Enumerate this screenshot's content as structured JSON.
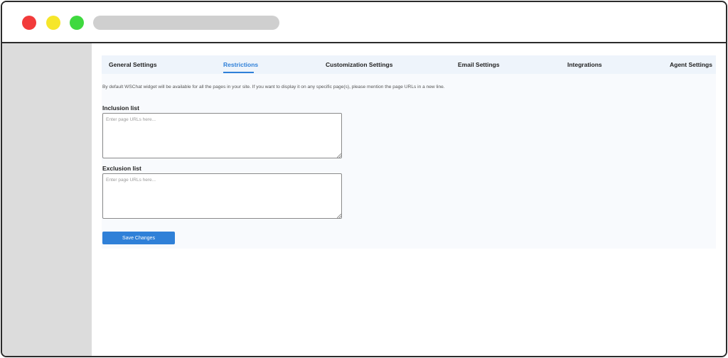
{
  "window": {
    "controls": [
      {
        "name": "close",
        "color": "#f23b3b"
      },
      {
        "name": "minimize",
        "color": "#f6e62a"
      },
      {
        "name": "maximize",
        "color": "#3fd93f"
      }
    ]
  },
  "tabs": [
    {
      "label": "General Settings",
      "active": false
    },
    {
      "label": "Restrictions",
      "active": true
    },
    {
      "label": "Customization Settings",
      "active": false
    },
    {
      "label": "Email Settings",
      "active": false
    },
    {
      "label": "Integrations",
      "active": false
    },
    {
      "label": "Agent Settings",
      "active": false
    }
  ],
  "restrictions": {
    "description": "By default WSChat widget will be available for all the pages in your site. If you want to display it on any specific page(s), please mention the page URLs in a new line.",
    "inclusion": {
      "label": "Inclusion list",
      "placeholder": "Enter page URLs here...",
      "value": ""
    },
    "exclusion": {
      "label": "Exclusion list",
      "placeholder": "Enter page URLs here...",
      "value": ""
    },
    "save_label": "Save Changes"
  },
  "colors": {
    "accent": "#2f80d8",
    "tab_bar": "#eef4fb",
    "sidebar": "#dcdcdc"
  }
}
